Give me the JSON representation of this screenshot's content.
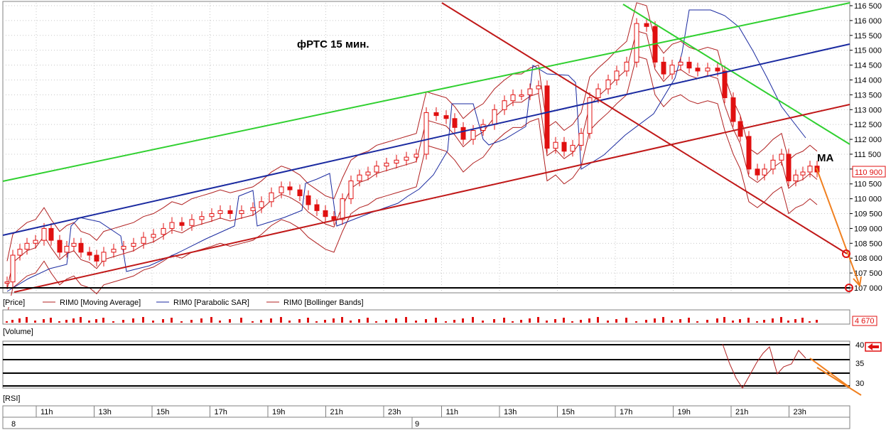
{
  "chart_data": [
    {
      "type": "candlestick",
      "title": "фРТС   15 мин.",
      "annotation": "MA",
      "price_tag": "110 900",
      "ylim": [
        107000,
        116500
      ],
      "y_ticks": [
        "116 500",
        "116 000",
        "115 500",
        "115 000",
        "114 500",
        "114 000",
        "113 500",
        "113 000",
        "112 500",
        "112 000",
        "111 500",
        "111 000",
        "110 500",
        "110 000",
        "109 500",
        "109 000",
        "108 500",
        "108 000",
        "107 500",
        "107 000"
      ],
      "legend": [
        {
          "name": "[Price]",
          "color": "#000000"
        },
        {
          "name": "RIM0 [Moving Average]",
          "color": "#b02020"
        },
        {
          "name": "RIM0 [Parabolic SAR]",
          "color": "#1a2aa0"
        },
        {
          "name": "RIM0 [Bollinger Bands]",
          "color": "#b02020"
        }
      ],
      "trend_lines_color": {
        "green": "#30d030",
        "blue": "#1a2aa0",
        "red": "#c01818",
        "orange": "#f08020"
      }
    },
    {
      "type": "bar",
      "title": "[Volume]",
      "value_tag": "4 670"
    },
    {
      "type": "line",
      "title": "[RSI]",
      "y_ticks": [
        "40",
        "35",
        "30"
      ],
      "ylim": [
        28,
        41
      ]
    }
  ],
  "time_axis": {
    "hour_labels": [
      "11h",
      "13h",
      "15h",
      "17h",
      "19h",
      "21h",
      "23h",
      "11h",
      "13h",
      "15h",
      "17h",
      "19h",
      "21h",
      "23h"
    ],
    "day_labels": [
      "8",
      "9"
    ]
  },
  "colors": {
    "bull": "#ffffff",
    "bear": "#e01010",
    "grid": "#c8c8c8",
    "axis": "#808080"
  }
}
